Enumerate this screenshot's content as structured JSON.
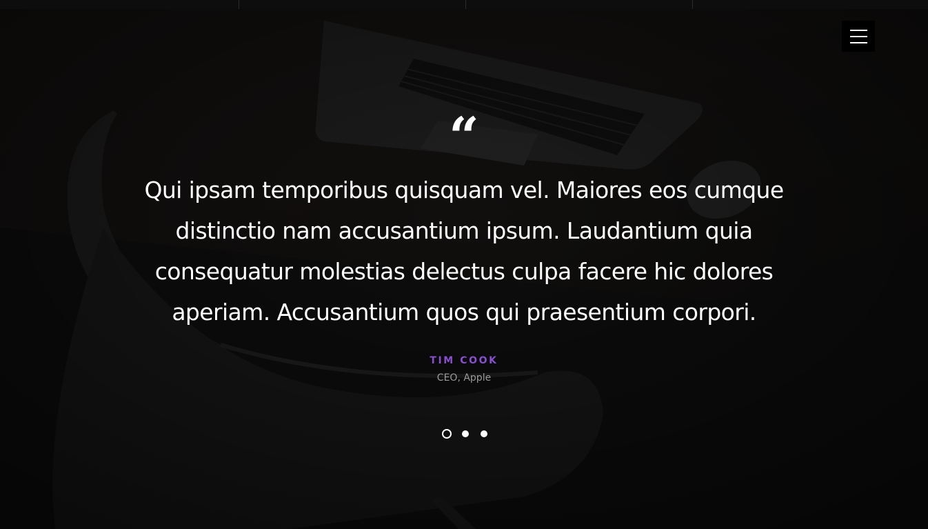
{
  "nav": {
    "menu_icon": "hamburger-menu-icon"
  },
  "testimonial": {
    "quote_icon": "quote-mark-icon",
    "quote_glyph": "“",
    "text": "Qui ipsam temporibus quisquam vel. Maiores eos cumque distinctio nam accusantium ipsum. Laudantium quia consequatur molestias delectus culpa facere hic dolores aperiam. Accusantium quos qui praesentium corpori.",
    "author": "TIM COOK",
    "role": "CEO, Apple"
  },
  "slider": {
    "total": 3,
    "active_index": 0
  },
  "colors": {
    "background": "#141414",
    "accent": "#8a4fd0",
    "text": "#ffffff",
    "muted": "#9a9a9a"
  }
}
